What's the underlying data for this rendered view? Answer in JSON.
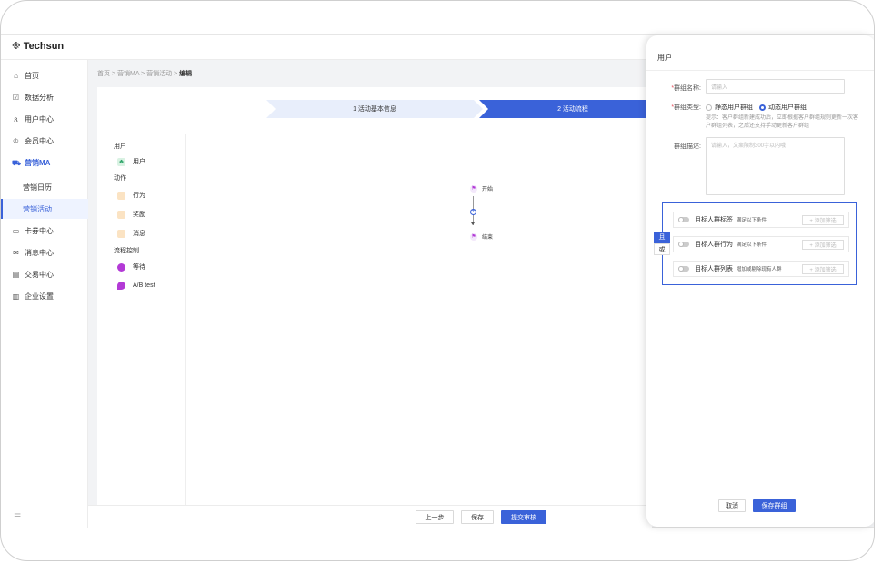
{
  "app": {
    "brand": "Techsun"
  },
  "sidebar": {
    "items": [
      {
        "label": "首页",
        "icon": "home-icon"
      },
      {
        "label": "数据分析",
        "icon": "chart-icon"
      },
      {
        "label": "用户中心",
        "icon": "users-icon"
      },
      {
        "label": "会员中心",
        "icon": "crown-icon"
      },
      {
        "label": "营销MA",
        "icon": "cart-icon"
      },
      {
        "label": "营销日历",
        "icon": ""
      },
      {
        "label": "营销活动",
        "icon": ""
      },
      {
        "label": "卡券中心",
        "icon": "ticket-icon"
      },
      {
        "label": "消息中心",
        "icon": "mail-icon"
      },
      {
        "label": "交易中心",
        "icon": "card-icon"
      },
      {
        "label": "企业设置",
        "icon": "building-icon"
      }
    ]
  },
  "breadcrumb": {
    "items": [
      "首页",
      "营销MA",
      "营销活动"
    ],
    "current": "编辑",
    "sep": " > "
  },
  "steps": {
    "step1": "1 活动基本信息",
    "step2": "2 活动流程"
  },
  "palette": {
    "group_user": "用户",
    "user": "用户",
    "group_action": "动作",
    "action_behavior": "行为",
    "action_reward": "奖励",
    "action_message": "消息",
    "group_flow": "流程控制",
    "flow_wait": "等待",
    "flow_abtest": "A/B test"
  },
  "canvas": {
    "start": "开始",
    "end": "结束"
  },
  "footer": {
    "prev": "上一步",
    "save": "保存",
    "submit": "提交审核"
  },
  "panel": {
    "title": "用户",
    "name_label": "群组名称:",
    "name_placeholder": "请输入",
    "type_label": "群组类型:",
    "type_static": "静态用户群组",
    "type_dynamic": "动态用户群组",
    "hint": "提示：客户群组新建成功后，立即根据客户群组规则更新一次客户群组列表，之后还支持手动更新客户群组",
    "desc_label": "群组描述:",
    "desc_placeholder": "请输入，文案限制300字以内哦",
    "logic_and": "且",
    "logic_or": "或",
    "conditions": [
      {
        "name": "目标人群标签",
        "desc": "满足以下条件",
        "add": "+ 添加筛选"
      },
      {
        "name": "目标人群行为",
        "desc": "满足以下条件",
        "add": "+ 添加筛选"
      },
      {
        "name": "目标人群列表",
        "desc": "增加或剔除现有人群",
        "add": "+ 添加筛选"
      }
    ],
    "cancel": "取消",
    "save": "保存群组"
  },
  "colors": {
    "accent": "#3a62d9",
    "required": "#e34d59"
  }
}
